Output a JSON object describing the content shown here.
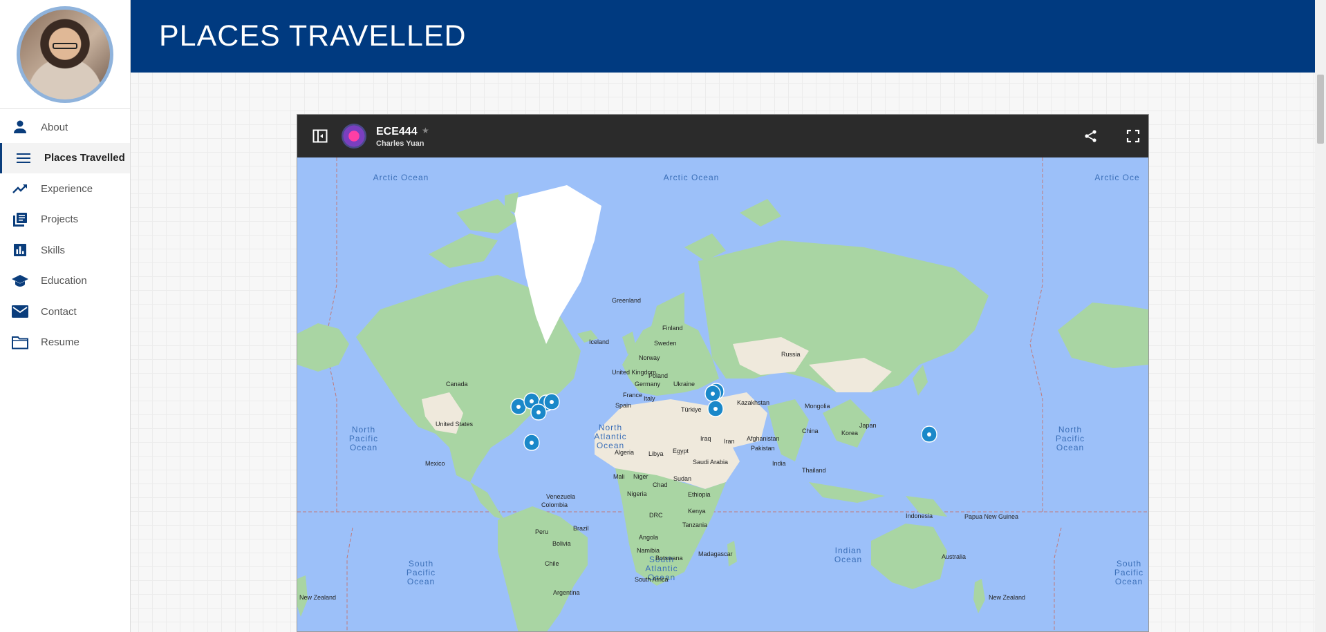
{
  "sidebar": {
    "items": [
      {
        "label": "About",
        "icon": "person-icon"
      },
      {
        "label": "Places Travelled",
        "icon": "menu-icon",
        "active": true
      },
      {
        "label": "Experience",
        "icon": "trending-up-icon"
      },
      {
        "label": "Projects",
        "icon": "library-books-icon"
      },
      {
        "label": "Skills",
        "icon": "bar-chart-icon"
      },
      {
        "label": "Education",
        "icon": "school-icon"
      },
      {
        "label": "Contact",
        "icon": "mail-icon"
      },
      {
        "label": "Resume",
        "icon": "folder-icon"
      }
    ]
  },
  "header": {
    "title": "PLACES TRAVELLED"
  },
  "map": {
    "title": "ECE444",
    "owner": "Charles Yuan",
    "oceans": {
      "arctic_left": "Arctic Ocean",
      "arctic_mid": "Arctic Ocean",
      "arctic_right": "Arctic Oce",
      "npac_left": [
        "North",
        "Pacific",
        "Ocean"
      ],
      "natl": [
        "North",
        "Atlantic",
        "Ocean"
      ],
      "npac_right": [
        "North",
        "Pacific",
        "Ocean"
      ],
      "spac_left": [
        "South",
        "Pacific",
        "Ocean"
      ],
      "satl": [
        "South",
        "Atlantic",
        "Ocean"
      ],
      "indian": [
        "Indian",
        "Ocean"
      ],
      "spac_right": [
        "South",
        "Pacific",
        "Ocean"
      ]
    },
    "places": {
      "greenland": "Greenland",
      "iceland": "Iceland",
      "finland": "Finland",
      "sweden": "Sweden",
      "norway": "Norway",
      "uk": "United Kingdom",
      "poland": "Poland",
      "germany": "Germany",
      "ukraine": "Ukraine",
      "france": "France",
      "italy": "Italy",
      "spain": "Spain",
      "turkiye": "Türkiye",
      "russia": "Russia",
      "kazakhstan": "Kazakhstan",
      "mongolia": "Mongolia",
      "china": "China",
      "korea": "Korea",
      "japan": "Japan",
      "canada": "Canada",
      "us": "United States",
      "mexico": "Mexico",
      "iraq": "Iraq",
      "iran": "Iran",
      "afghanistan": "Afghanistan",
      "pakistan": "Pakistan",
      "india": "India",
      "thailand": "Thailand",
      "saudi": "Saudi Arabia",
      "egypt": "Egypt",
      "libya": "Libya",
      "algeria": "Algeria",
      "mali": "Mali",
      "niger": "Niger",
      "chad": "Chad",
      "sudan": "Sudan",
      "nigeria": "Nigeria",
      "ethiopia": "Ethiopia",
      "drc": "DRC",
      "kenya": "Kenya",
      "tanzania": "Tanzania",
      "angola": "Angola",
      "namibia": "Namibia",
      "botswana": "Botswana",
      "madagascar": "Madagascar",
      "southafrica": "South Africa",
      "venezuela": "Venezuela",
      "colombia": "Colombia",
      "peru": "Peru",
      "brazil": "Brazil",
      "bolivia": "Bolivia",
      "chile": "Chile",
      "argentina": "Argentina",
      "indonesia": "Indonesia",
      "png": "Papua New Guinea",
      "australia": "Australia",
      "nz_left": "New Zealand",
      "nz_right": "New Zealand"
    }
  },
  "colors": {
    "header": "#003a80",
    "accent": "#0a3d7c",
    "marker": "#1a88c9"
  }
}
